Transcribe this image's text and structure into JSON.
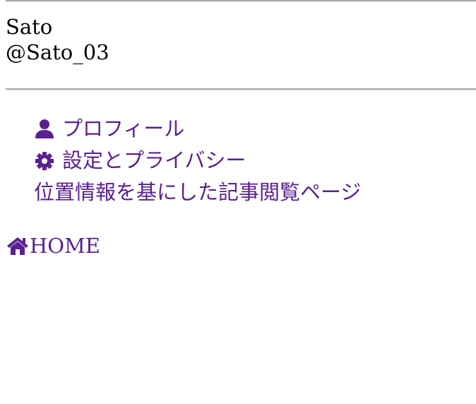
{
  "user": {
    "name": "Sato",
    "handle": "@Sato_03"
  },
  "menu": {
    "items": [
      {
        "label": "プロフィール",
        "icon": "user-icon"
      },
      {
        "label": "設定とプライバシー",
        "icon": "gear-icon"
      },
      {
        "label": "位置情報を基にした記事閲覧ページ",
        "icon": ""
      }
    ]
  },
  "home": {
    "label": "HOME",
    "icon": "home-icon"
  },
  "colors": {
    "link": "#5a2192",
    "divider": "#a8a8a8",
    "background": "#ffffff"
  }
}
